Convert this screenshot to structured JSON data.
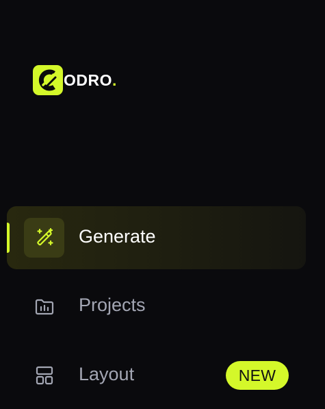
{
  "brand": {
    "logo_text": "ODRO",
    "logo_dot": ".",
    "accent_color": "#d4f82a"
  },
  "nav": {
    "items": [
      {
        "label": "Generate",
        "icon": "magic-wand-icon",
        "active": true
      },
      {
        "label": "Projects",
        "icon": "folder-icon",
        "active": false
      },
      {
        "label": "Layout",
        "icon": "layout-icon",
        "active": false,
        "badge": "NEW"
      }
    ]
  }
}
